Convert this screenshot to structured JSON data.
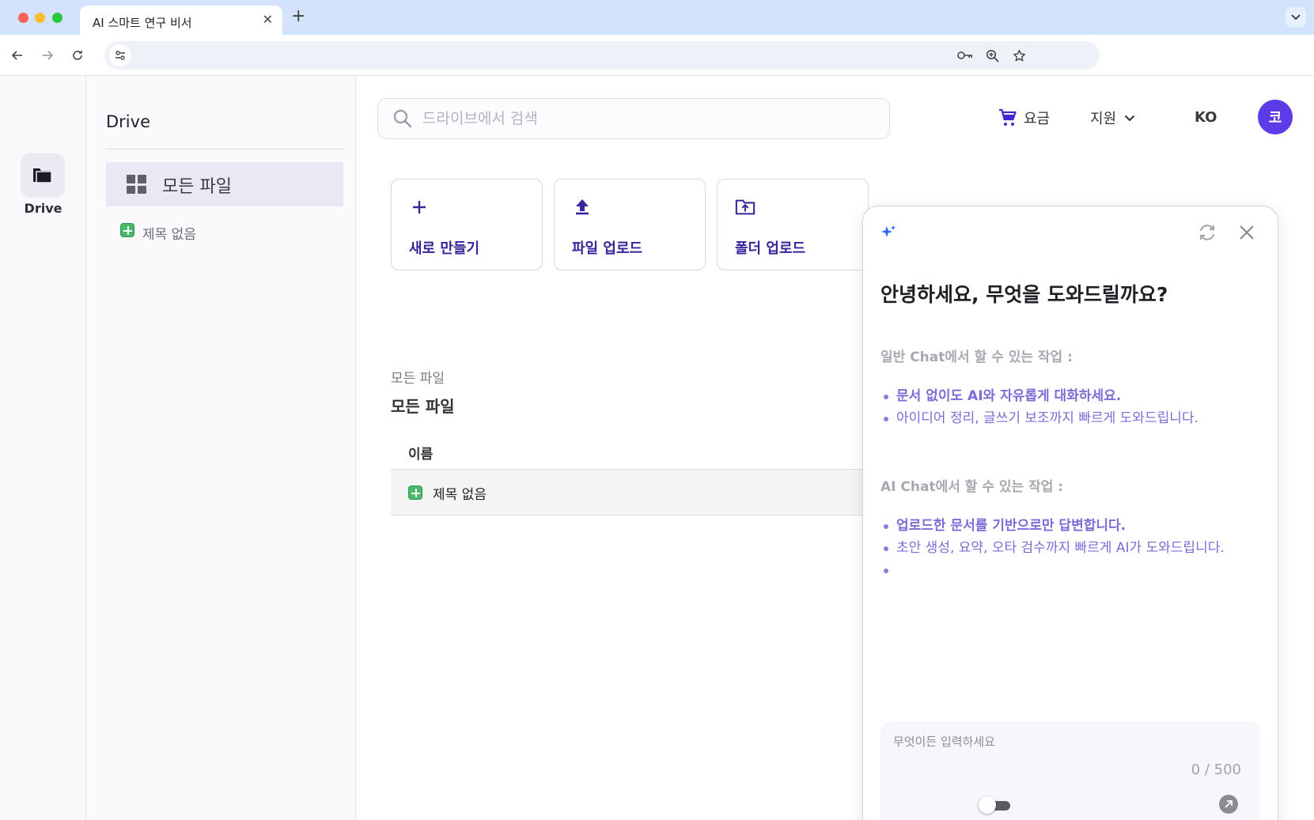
{
  "browser": {
    "tab_title": "AI 스마트 연구 비서",
    "tab_close": "✕",
    "new_tab": "+"
  },
  "rail": {
    "label": "Drive"
  },
  "sidebar": {
    "title": "Drive",
    "all_files_label": "모든 파일",
    "files": [
      {
        "label": "제목 없음"
      }
    ]
  },
  "header": {
    "search_placeholder": "드라이브에서 검색",
    "pricing_label": "요금",
    "support_label": "지원",
    "language": "KO",
    "avatar_initial": "코"
  },
  "actions": [
    {
      "label": "새로 만들기",
      "icon": "plus-icon"
    },
    {
      "label": "파일 업로드",
      "icon": "upload-icon"
    },
    {
      "label": "폴더 업로드",
      "icon": "folder-upload-icon"
    }
  ],
  "files_view": {
    "breadcrumb": "모든 파일",
    "title": "모든 파일",
    "column_name": "이름",
    "rows": [
      {
        "name": "제목 없음"
      }
    ]
  },
  "chat": {
    "heading": "안녕하세요, 무엇을 도와드릴까요?",
    "general_title": "일반 Chat에서 할 수 있는 작업 :",
    "general_items": [
      "문서 없이도 AI와 자유롭게 대화하세요.",
      "아이디어 정리, 글쓰기 보조까지 빠르게 도와드립니다."
    ],
    "ai_title": "AI Chat에서 할 수 있는 작업 :",
    "ai_items": [
      "업로드한 문서를 기반으로만 답변합니다.",
      "초안 생성, 요약, 오타 검수까지 빠르게 AI가 도와드립니다.",
      ""
    ],
    "input_placeholder": "무엇이든 입력하세요",
    "counter": "0 / 500"
  },
  "colors": {
    "accent": "#5b3ce6",
    "action_text": "#3a239b",
    "chat_list": "#7f6ad8"
  }
}
